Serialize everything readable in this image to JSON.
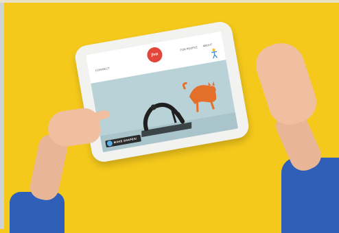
{
  "app": {
    "logo_text": "jiva",
    "nav_left": "CONNECT",
    "nav_right": [
      "FOR PEOPLE",
      "ABOUT"
    ],
    "badge": "MAKE SHAPES!"
  },
  "colors": {
    "background": "#f4c91c",
    "logo": "#e2463a",
    "sleeves": "#2f5fb7",
    "video_bg": "#b9d2d8",
    "cat": "#e36f2b"
  }
}
